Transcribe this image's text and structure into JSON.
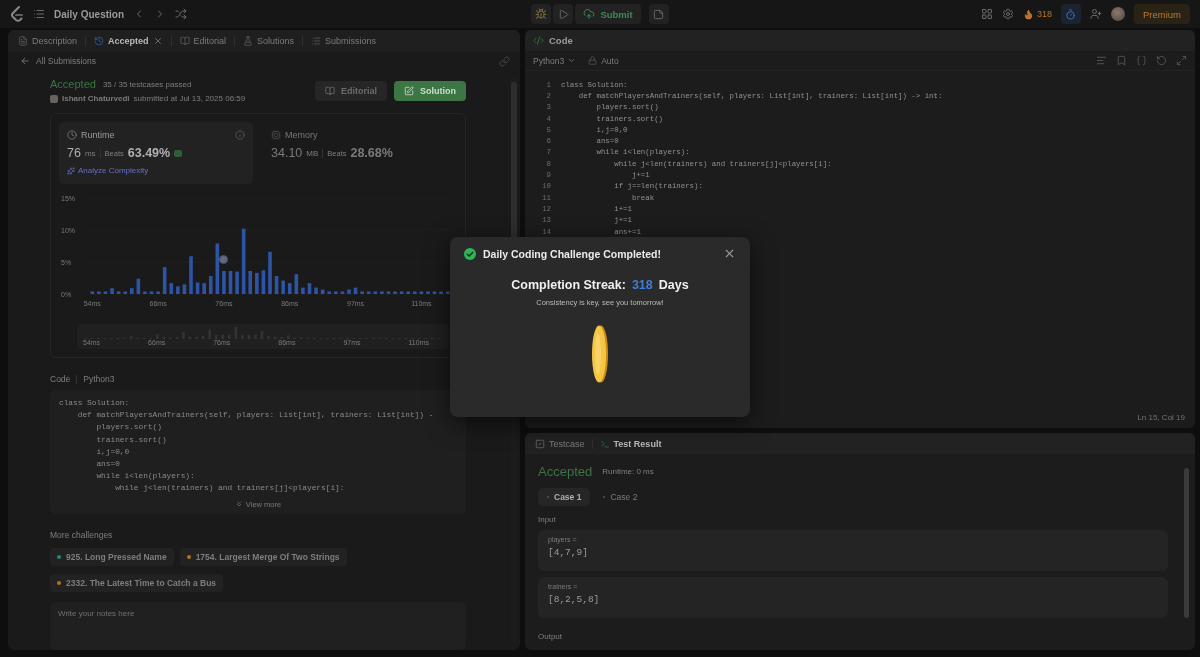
{
  "topbar": {
    "title": "Daily Question",
    "submit": "Submit",
    "streak": "318",
    "premium": "Premium"
  },
  "left_panel": {
    "tabs": [
      {
        "label": "Description",
        "selected": false,
        "closable": false
      },
      {
        "label": "Accepted",
        "selected": true,
        "closable": true
      },
      {
        "label": "Editorial",
        "selected": false,
        "closable": false
      },
      {
        "label": "Solutions",
        "selected": false,
        "closable": false
      },
      {
        "label": "Submissions",
        "selected": false,
        "closable": false
      }
    ],
    "back_link": "All Submissions",
    "submission": {
      "status": "Accepted",
      "passed": "35 / 35 testcases passed",
      "author": "Ishant Chaturvedi",
      "submitted": "submitted at Jul 13, 2025 06:59",
      "buttons": [
        {
          "label": "Editorial",
          "kind": "secondary"
        },
        {
          "label": "Solution",
          "kind": "primary"
        }
      ]
    },
    "stats": [
      {
        "kind": "runtime",
        "label": "Runtime",
        "value": "76",
        "unit": "ms",
        "beats_label": "Beats",
        "beats": "63.49%",
        "selected": true,
        "link": "Analyze Complexity"
      },
      {
        "kind": "memory",
        "label": "Memory",
        "value": "34.10",
        "unit": "MB",
        "beats_label": "Beats",
        "beats": "28.68%",
        "selected": false
      }
    ],
    "chart_data": {
      "type": "bar",
      "ylim": [
        0,
        15
      ],
      "values": [
        0.4,
        0.4,
        0.4,
        0.9,
        0.4,
        0.4,
        0.9,
        2.4,
        0.4,
        0.4,
        0.4,
        4.2,
        1.7,
        1.2,
        1.5,
        5.9,
        1.8,
        1.7,
        2.8,
        7.9,
        3.6,
        3.6,
        3.5,
        10.2,
        3.6,
        3.3,
        3.7,
        6.6,
        2.8,
        2.1,
        1.7,
        3.1,
        1.0,
        1.7,
        1.0,
        0.7,
        0.4,
        0.4,
        0.4,
        0.7,
        1.0,
        0.4,
        0.4,
        0.4,
        0.4,
        0.4,
        0.4,
        0.4,
        0.4,
        0.4,
        0.4,
        0.4,
        0.4,
        0.4,
        0.4
      ],
      "categories": [
        "54ms",
        null,
        null,
        null,
        null,
        null,
        null,
        null,
        null,
        null,
        "66ms",
        null,
        null,
        null,
        null,
        null,
        null,
        null,
        null,
        null,
        "76ms",
        null,
        null,
        null,
        null,
        null,
        null,
        null,
        null,
        null,
        "86ms",
        null,
        null,
        null,
        null,
        null,
        null,
        null,
        null,
        null,
        "97ms",
        null,
        null,
        null,
        null,
        null,
        null,
        null,
        null,
        null,
        "110ms",
        null,
        null,
        null,
        null
      ],
      "yticks": [
        {
          "value": 0,
          "label": "0%"
        },
        {
          "value": 5,
          "label": "5%"
        },
        {
          "value": 10,
          "label": "10%"
        },
        {
          "value": 15,
          "label": "15%"
        }
      ]
    },
    "overview_labels": [
      "54ms",
      "66ms",
      "76ms",
      "86ms",
      "97ms",
      "110ms"
    ],
    "code_header": {
      "title": "Code",
      "language": "Python3"
    },
    "code_lines": [
      "class Solution:",
      "    def matchPlayersAndTrainers(self, players: List[int], trainers: List[int]) -",
      "        players.sort()",
      "        trainers.sort()",
      "        i,j=0,0",
      "        ans=0",
      "        while i<len(players):",
      "            while j<len(trainers) and trainers[j]<players[i]:"
    ],
    "view_more": "View more",
    "more_challenges": {
      "title": "More challenges",
      "items": [
        {
          "label": "925. Long Pressed Name",
          "color": "#1f8a7c"
        },
        {
          "label": "1754. Largest Merge Of Two Strings",
          "color": "#b0741c"
        },
        {
          "label": "2332. The Latest Time to Catch a Bus",
          "color": "#b0741c"
        }
      ]
    },
    "notes": {
      "placeholder": "Write your notes here"
    }
  },
  "editor": {
    "title": "Code",
    "language": "Python3",
    "mode": "Auto",
    "cursor": "Ln 15, Col 19",
    "lines": [
      {
        "number": "1",
        "text": "class Solution:"
      },
      {
        "number": "2",
        "text": "    def matchPlayersAndTrainers(self, players: List[int], trainers: List[int]) -> int:"
      },
      {
        "number": "3",
        "text": "        players.sort()"
      },
      {
        "number": "4",
        "text": "        trainers.sort()"
      },
      {
        "number": "5",
        "text": "        i,j=0,0"
      },
      {
        "number": "6",
        "text": "        ans=0"
      },
      {
        "number": "7",
        "text": "        while i<len(players):"
      },
      {
        "number": "8",
        "text": "            while j<len(trainers) and trainers[j]<players[i]:"
      },
      {
        "number": "9",
        "text": "                j+=1"
      },
      {
        "number": "10",
        "text": "            if j==len(trainers):"
      },
      {
        "number": "11",
        "text": "                break"
      },
      {
        "number": "12",
        "text": "            i+=1"
      },
      {
        "number": "13",
        "text": "            j+=1"
      },
      {
        "number": "14",
        "text": "            ans+=1"
      }
    ]
  },
  "test_panel": {
    "tabs": [
      {
        "label": "Testcase",
        "selected": false
      },
      {
        "label": "Test Result",
        "selected": true
      }
    ],
    "status": "Accepted",
    "runtime": "Runtime: 0 ms",
    "cases": [
      {
        "label": "Case 1",
        "selected": true
      },
      {
        "label": "Case 2",
        "selected": false
      }
    ],
    "input_label": "Input",
    "inputs": [
      {
        "name": "players =",
        "value": "[4,7,9]"
      },
      {
        "name": "trainers =",
        "value": "[8,2,5,8]"
      }
    ],
    "output_label": "Output"
  },
  "modal": {
    "title": "Daily Coding Challenge Completed!",
    "streak_label": "Completion Streak:",
    "streak_value": "318",
    "streak_unit": "Days",
    "message": "Consistency is key, see you tomorrow!"
  }
}
